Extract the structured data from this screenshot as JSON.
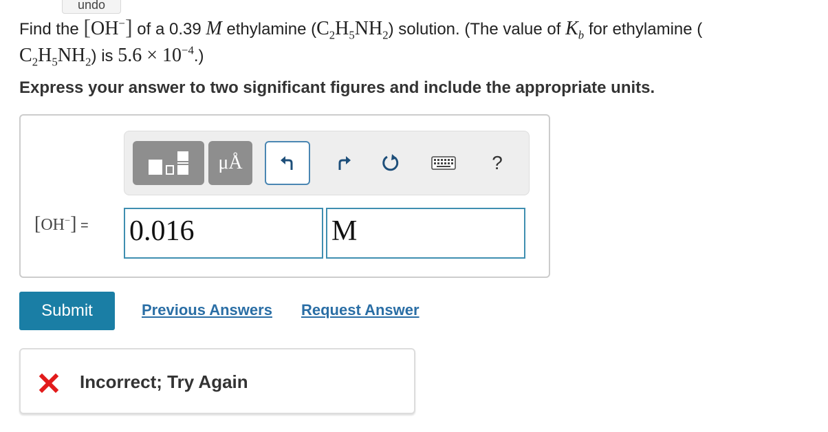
{
  "tooltip": "undo",
  "question": {
    "p1": "Find the ",
    "oh": "OH",
    "oh_sup": "−",
    "p2": " of a 0.39 ",
    "m": "M",
    "p3": " ethylamine (",
    "formula_a": "C",
    "formula_a_sub": "2",
    "formula_b": "H",
    "formula_b_sub": "5",
    "formula_c": "NH",
    "formula_c_sub": "2",
    "p4": ") solution. (The value of ",
    "k": "K",
    "k_sub": "b",
    "p5": " for ethylamine (",
    "p6": ") is ",
    "kb_value": "5.6 × 10",
    "kb_exp": "−4",
    "p7": ".)"
  },
  "instruction": "Express your answer to two significant figures and include the appropriate units.",
  "toolbar": {
    "units_label": "μÅ",
    "help_label": "?",
    "icons": [
      "templates-icon",
      "units-icon",
      "undo-icon",
      "redo-icon",
      "reset-icon",
      "keyboard-icon",
      "help-icon"
    ]
  },
  "answer": {
    "label_oh": "OH",
    "label_sup": "−",
    "equals": "=",
    "value": "0.016",
    "unit": "M"
  },
  "buttons": {
    "submit": "Submit",
    "previous_answers": "Previous Answers",
    "request_answer": "Request Answer"
  },
  "feedback": {
    "text": "Incorrect; Try Again",
    "color": "#e21b1b"
  },
  "colors": {
    "accent": "#1a7ea5",
    "link": "#2a6ea5",
    "input_border": "#3e8eb0"
  }
}
